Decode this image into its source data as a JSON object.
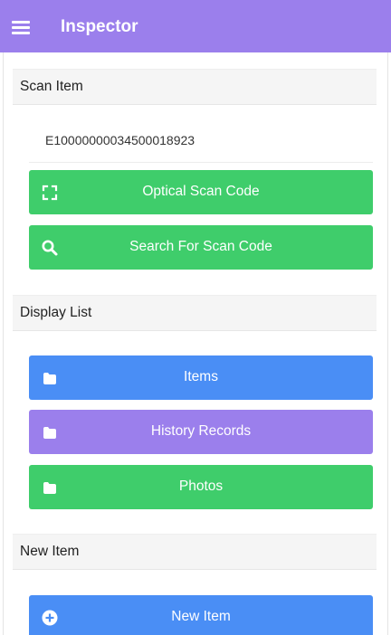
{
  "header": {
    "title": "Inspector",
    "menu_icon": "hamburger-menu-icon",
    "background_color": "#9b7fec"
  },
  "scan_item": {
    "section_label": "Scan Item",
    "code_value": "E10000000034500018923",
    "optical_scan": {
      "label": "Optical Scan Code",
      "icon": "scan-frame-icon",
      "color": "#3fcd6b"
    },
    "search_scan": {
      "label": "Search For Scan Code",
      "icon": "search-icon",
      "color": "#3fcd6b"
    }
  },
  "display_list": {
    "section_label": "Display List",
    "items": {
      "label": "Items",
      "icon": "folder-icon",
      "color": "#4a8ef5"
    },
    "history": {
      "label": "History Records",
      "icon": "folder-icon",
      "color": "#9b7fec"
    },
    "photos": {
      "label": "Photos",
      "icon": "folder-icon",
      "color": "#3fcd6b"
    }
  },
  "new_item": {
    "section_label": "New Item",
    "button": {
      "label": "New Item",
      "icon": "plus-circle-icon",
      "color": "#4a8ef5"
    }
  }
}
